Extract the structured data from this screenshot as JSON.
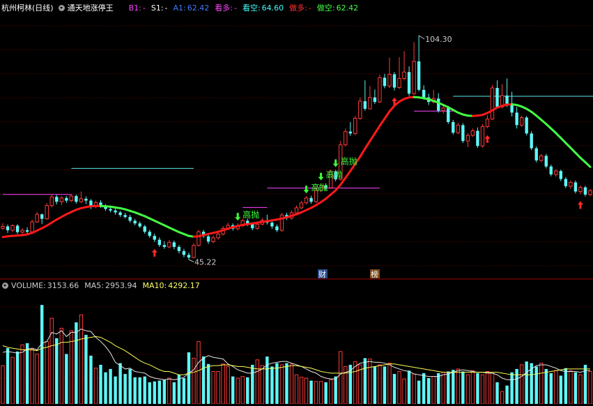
{
  "header": {
    "stock_name": "杭州柯林(日线)",
    "indicator_name": "通天地涨停王",
    "items": [
      {
        "label": "B1:",
        "value": "-",
        "color": "#ff44ff"
      },
      {
        "label": "S1:",
        "value": "-",
        "color": "#ffffff"
      },
      {
        "label": "A1:",
        "value": "62.42",
        "color": "#3f7bff"
      },
      {
        "label": "看多:",
        "value": "-",
        "color": "#ff44ff"
      },
      {
        "label": "看空:",
        "value": "64.60",
        "color": "#44ffff"
      },
      {
        "label": "做多:",
        "value": "-",
        "color": "#ff3333"
      },
      {
        "label": "做空:",
        "value": "62.42",
        "color": "#44ff44"
      }
    ]
  },
  "volume_header": {
    "items": [
      {
        "label": "VOLUME:",
        "value": "3153.66",
        "color": "#cccccc"
      },
      {
        "label": "MA5:",
        "value": "2953.94",
        "color": "#cccccc"
      },
      {
        "label": "MA10:",
        "value": "4292.17",
        "color": "#ffff66"
      }
    ]
  },
  "colors": {
    "up": "#ff3b3b",
    "down": "#5ff5f5",
    "grid": "#7a0000",
    "ma_up": "#ff1a1a",
    "ma_down": "#44ff44"
  },
  "chart_data": {
    "type": "candlestick",
    "price_range": [
      40.5,
      110.0
    ],
    "high_label": "104.30",
    "low_label": "45.22",
    "signal_label": "高抛",
    "badges": [
      "财",
      "榜"
    ],
    "candles": [
      [
        53.5,
        54.0,
        54.9,
        53.1
      ],
      [
        54.0,
        53.0,
        54.5,
        52.3
      ],
      [
        53.0,
        54.2,
        54.6,
        52.5
      ],
      [
        54.2,
        52.5,
        54.6,
        52.0
      ],
      [
        52.5,
        53.0,
        53.5,
        51.9
      ],
      [
        53.0,
        52.6,
        53.8,
        52.0
      ],
      [
        52.6,
        55.2,
        55.8,
        52.4
      ],
      [
        55.2,
        57.2,
        57.8,
        54.9
      ],
      [
        57.2,
        56.0,
        57.4,
        54.6
      ],
      [
        56.0,
        59.5,
        60.1,
        55.8
      ],
      [
        59.5,
        61.8,
        62.5,
        59.0
      ],
      [
        61.8,
        60.5,
        62.3,
        59.8
      ],
      [
        60.5,
        61.5,
        62.0,
        59.6
      ],
      [
        61.5,
        60.8,
        62.0,
        60.2
      ],
      [
        60.8,
        62.0,
        62.6,
        60.4
      ],
      [
        62.0,
        60.5,
        62.4,
        60.0
      ],
      [
        60.5,
        61.3,
        63.2,
        60.2
      ],
      [
        61.3,
        60.8,
        61.9,
        59.9
      ],
      [
        60.8,
        59.2,
        61.2,
        58.6
      ],
      [
        59.2,
        60.3,
        60.8,
        58.8
      ],
      [
        60.3,
        59.4,
        60.9,
        58.9
      ],
      [
        59.4,
        58.6,
        59.9,
        58.1
      ],
      [
        58.6,
        58.2,
        59.2,
        57.7
      ],
      [
        58.2,
        57.7,
        58.7,
        57.1
      ],
      [
        57.7,
        57.0,
        58.1,
        56.5
      ],
      [
        57.0,
        56.5,
        57.6,
        56.1
      ],
      [
        56.5,
        55.5,
        57.1,
        55.0
      ],
      [
        55.5,
        54.8,
        56.0,
        54.3
      ],
      [
        54.8,
        54.0,
        55.3,
        53.6
      ],
      [
        54.0,
        52.6,
        54.4,
        52.1
      ],
      [
        52.6,
        51.5,
        53.1,
        51.0
      ],
      [
        51.5,
        50.5,
        52.1,
        49.9
      ],
      [
        50.5,
        49.1,
        51.1,
        48.6
      ],
      [
        49.1,
        48.6,
        50.1,
        48.1
      ],
      [
        48.6,
        49.8,
        50.4,
        48.2
      ],
      [
        49.8,
        48.6,
        50.3,
        48.0
      ],
      [
        48.6,
        47.5,
        49.1,
        46.9
      ],
      [
        47.5,
        46.5,
        48.1,
        45.9
      ],
      [
        46.5,
        45.8,
        47.1,
        45.22
      ],
      [
        45.8,
        49.0,
        49.6,
        45.6
      ],
      [
        49.0,
        52.6,
        53.1,
        48.7
      ],
      [
        52.6,
        51.4,
        53.1,
        50.9
      ],
      [
        51.4,
        50.0,
        51.9,
        49.4
      ],
      [
        50.0,
        51.0,
        51.6,
        49.6
      ],
      [
        51.0,
        52.0,
        52.6,
        50.5
      ],
      [
        52.0,
        53.5,
        54.1,
        51.6
      ],
      [
        53.5,
        54.3,
        55.0,
        53.0
      ],
      [
        54.3,
        53.4,
        54.8,
        52.9
      ],
      [
        53.4,
        54.2,
        54.8,
        52.9
      ],
      [
        54.2,
        55.5,
        56.0,
        53.8
      ],
      [
        55.5,
        54.6,
        56.1,
        54.1
      ],
      [
        54.6,
        53.5,
        55.1,
        53.0
      ],
      [
        53.5,
        54.6,
        55.2,
        53.1
      ],
      [
        54.6,
        55.6,
        56.2,
        54.3
      ],
      [
        55.6,
        55.0,
        57.1,
        54.5
      ],
      [
        55.0,
        54.0,
        55.6,
        53.4
      ],
      [
        54.0,
        53.0,
        54.5,
        52.5
      ],
      [
        53.0,
        57.0,
        57.6,
        52.6
      ],
      [
        57.0,
        56.2,
        57.6,
        55.7
      ],
      [
        56.2,
        57.6,
        58.2,
        55.8
      ],
      [
        57.6,
        58.9,
        59.5,
        57.2
      ],
      [
        58.9,
        60.2,
        60.7,
        58.5
      ],
      [
        60.2,
        61.5,
        62.0,
        59.8
      ],
      [
        61.5,
        60.5,
        62.1,
        60.0
      ],
      [
        60.5,
        63.5,
        64.1,
        60.2
      ],
      [
        63.5,
        64.8,
        65.4,
        63.1
      ],
      [
        64.8,
        64.2,
        65.3,
        63.6
      ],
      [
        64.2,
        68.5,
        69.0,
        63.9
      ],
      [
        68.5,
        66.4,
        68.9,
        65.9
      ],
      [
        66.4,
        75.5,
        76.5,
        66.1
      ],
      [
        75.5,
        79.0,
        79.8,
        75.1
      ],
      [
        79.0,
        78.5,
        81.5,
        77.9
      ],
      [
        78.5,
        82.5,
        83.1,
        78.0
      ],
      [
        82.5,
        87.0,
        88.0,
        82.1
      ],
      [
        87.0,
        85.0,
        92.5,
        84.5
      ],
      [
        85.0,
        88.0,
        91.0,
        84.8
      ],
      [
        88.0,
        86.8,
        90.1,
        86.3
      ],
      [
        86.8,
        93.2,
        94.0,
        86.5
      ],
      [
        93.2,
        91.0,
        94.2,
        90.4
      ],
      [
        91.0,
        94.1,
        98.5,
        90.5
      ],
      [
        94.1,
        90.6,
        94.7,
        89.8
      ],
      [
        90.6,
        93.0,
        98.6,
        90.2
      ],
      [
        93.0,
        94.7,
        100.2,
        92.5
      ],
      [
        94.7,
        89.0,
        96.2,
        88.4
      ],
      [
        89.0,
        97.5,
        102.6,
        88.6
      ],
      [
        97.5,
        90.0,
        104.3,
        89.6
      ],
      [
        90.0,
        88.0,
        91.2,
        87.4
      ],
      [
        88.0,
        86.8,
        89.0,
        86.0
      ],
      [
        86.8,
        87.7,
        90.0,
        86.4
      ],
      [
        87.7,
        84.5,
        89.1,
        84.0
      ],
      [
        84.5,
        85.2,
        86.1,
        83.8
      ],
      [
        85.2,
        81.5,
        85.8,
        81.0
      ],
      [
        81.5,
        78.7,
        82.1,
        78.2
      ],
      [
        78.7,
        80.7,
        81.3,
        78.3
      ],
      [
        80.7,
        76.5,
        81.2,
        76.0
      ],
      [
        76.5,
        78.0,
        78.6,
        74.9
      ],
      [
        78.0,
        79.2,
        79.8,
        77.6
      ],
      [
        79.2,
        75.2,
        80.1,
        74.7
      ],
      [
        75.2,
        80.3,
        81.0,
        74.8
      ],
      [
        80.3,
        82.3,
        83.3,
        79.9
      ],
      [
        82.3,
        90.5,
        91.3,
        82.0
      ],
      [
        90.5,
        85.5,
        92.5,
        85.0
      ],
      [
        85.5,
        88.5,
        91.5,
        85.1
      ],
      [
        88.5,
        86.0,
        93.0,
        85.5
      ],
      [
        86.0,
        84.0,
        89.5,
        83.0
      ],
      [
        84.0,
        80.7,
        85.5,
        79.8
      ],
      [
        80.7,
        82.7,
        83.2,
        80.2
      ],
      [
        82.7,
        78.5,
        83.1,
        78.0
      ],
      [
        78.5,
        74.6,
        79.1,
        74.1
      ],
      [
        74.6,
        71.4,
        75.1,
        70.9
      ],
      [
        71.4,
        72.6,
        73.1,
        70.9
      ],
      [
        72.6,
        69.8,
        73.1,
        69.3
      ],
      [
        69.8,
        67.7,
        70.3,
        67.2
      ],
      [
        67.7,
        68.6,
        69.1,
        67.1
      ],
      [
        68.6,
        66.5,
        69.0,
        65.9
      ],
      [
        66.5,
        64.6,
        67.0,
        64.1
      ],
      [
        64.6,
        65.6,
        66.1,
        63.9
      ],
      [
        65.6,
        63.2,
        66.1,
        62.7
      ],
      [
        63.2,
        64.3,
        64.8,
        62.5
      ],
      [
        64.3,
        62.4,
        64.7,
        61.9
      ],
      [
        62.4,
        63.4,
        63.9,
        62.0
      ]
    ],
    "ma": [
      51.2,
      51.4,
      51.5,
      51.6,
      51.7,
      51.9,
      52.3,
      52.9,
      53.5,
      54.2,
      55.0,
      55.8,
      56.5,
      57.2,
      57.8,
      58.4,
      58.8,
      59.1,
      59.3,
      59.4,
      59.4,
      59.3,
      59.2,
      59.0,
      58.8,
      58.5,
      58.1,
      57.7,
      57.2,
      56.7,
      56.1,
      55.5,
      54.9,
      54.3,
      53.7,
      53.1,
      52.5,
      52.0,
      51.5,
      51.3,
      51.4,
      51.7,
      52.0,
      52.3,
      52.6,
      53.0,
      53.4,
      53.8,
      54.1,
      54.4,
      54.6,
      54.8,
      55.0,
      55.2,
      55.4,
      55.6,
      55.8,
      56.1,
      56.4,
      56.8,
      57.2,
      57.7,
      58.3,
      58.9,
      59.6,
      60.4,
      61.3,
      62.4,
      63.5,
      65.0,
      66.8,
      68.6,
      70.5,
      72.4,
      74.5,
      76.5,
      78.5,
      80.5,
      82.4,
      84.3,
      85.8,
      86.9,
      87.6,
      88.0,
      88.1,
      88.0,
      87.8,
      87.5,
      87.1,
      86.6,
      86.0,
      85.4,
      84.7,
      84.0,
      83.5,
      83.2,
      83.1,
      83.2,
      83.4,
      83.9,
      84.6,
      85.3,
      85.8,
      86.1,
      86.2,
      86.0,
      85.6,
      85.0,
      84.2,
      83.2,
      82.1,
      81.0,
      79.8,
      78.6,
      77.3,
      76.0,
      74.7,
      73.4,
      72.1,
      70.9,
      69.7
    ],
    "hlines": [
      {
        "y": 62.42,
        "color": "#ff44ff",
        "from": 0,
        "to": 14
      },
      {
        "y": 69.3,
        "color": "#55eeee",
        "from": 14,
        "to": 39
      },
      {
        "y": 59.0,
        "color": "#ff44ff",
        "from": 49,
        "to": 54
      },
      {
        "y": 64.1,
        "color": "#ff44ff",
        "from": 54,
        "to": 77
      },
      {
        "y": 84.4,
        "color": "#ff44ff",
        "from": 84,
        "to": 92
      },
      {
        "y": 88.3,
        "color": "#55eeee",
        "from": 92,
        "to": 121
      }
    ],
    "buy_arrows": [
      31,
      80,
      99,
      118
    ],
    "sell_signals": [
      48,
      62,
      65,
      68
    ],
    "volume": {
      "range": [
        0,
        13500
      ],
      "values": [
        4600,
        6700,
        5600,
        6300,
        7100,
        7300,
        6600,
        6000,
        11900,
        7500,
        10300,
        7900,
        9100,
        6000,
        8800,
        9800,
        10700,
        8300,
        5800,
        4300,
        4700,
        3800,
        4200,
        3300,
        4900,
        3600,
        4200,
        3200,
        3200,
        3300,
        2600,
        2700,
        2800,
        2900,
        3100,
        2600,
        3500,
        3100,
        6200,
        5500,
        7500,
        5700,
        4800,
        3900,
        3900,
        4800,
        4500,
        3300,
        3100,
        3300,
        3200,
        4700,
        5300,
        4600,
        5700,
        4500,
        4900,
        4700,
        4900,
        4800,
        3500,
        3200,
        3100,
        2800,
        2700,
        2700,
        2600,
        2900,
        3300,
        6300,
        4500,
        4700,
        5100,
        4700,
        5500,
        5400,
        4500,
        4700,
        4500,
        4900,
        3600,
        3900,
        3000,
        4000,
        3600,
        2800,
        3700,
        3100,
        3300,
        3700,
        3800,
        3900,
        4100,
        4200,
        3900,
        3500,
        4000,
        3700,
        3500,
        3900,
        3700,
        2600,
        1500,
        2200,
        3800,
        4200,
        4700,
        5100,
        4900,
        4500,
        4900,
        4200,
        3700,
        4000,
        3400,
        4300,
        4000,
        3800,
        3500,
        4700,
        3900
      ],
      "ma5": [
        6200,
        6300,
        6200,
        6100,
        6200,
        6600,
        6700,
        6500,
        7300,
        7500,
        8600,
        8400,
        8800,
        8100,
        8600,
        8600,
        9000,
        8800,
        8700,
        8000,
        7500,
        6900,
        6100,
        5000,
        4600,
        4200,
        4300,
        3900,
        3800,
        3700,
        3300,
        3100,
        3000,
        2900,
        3000,
        2900,
        3000,
        3200,
        3700,
        4100,
        5000,
        5500,
        5800,
        5600,
        5500,
        5400,
        4800,
        4500,
        4100,
        3900,
        3700,
        3700,
        3900,
        4200,
        4700,
        4900,
        5000,
        5100,
        5100,
        4900,
        4700,
        4500,
        4200,
        3900,
        3700,
        3300,
        3100,
        3000,
        3000,
        3600,
        3800,
        4000,
        4500,
        4900,
        5000,
        5100,
        5000,
        5000,
        4900,
        4700,
        4400,
        4200,
        4000,
        3900,
        3600,
        3500,
        3400,
        3300,
        3300,
        3300,
        3500,
        3600,
        3800,
        4000,
        4100,
        4000,
        3900,
        3800,
        3800,
        3700,
        3700,
        3500,
        3100,
        2900,
        2900,
        3000,
        3300,
        3800,
        4200,
        4600,
        4700,
        4700,
        4500,
        4300,
        4000,
        3900,
        3900,
        3900,
        3800,
        4000,
        4000
      ],
      "ma10": [
        7000,
        6800,
        6700,
        6600,
        6500,
        6500,
        6500,
        6400,
        6700,
        6800,
        7000,
        7100,
        7400,
        7400,
        7500,
        7600,
        7800,
        7900,
        8000,
        8100,
        8000,
        7700,
        7400,
        7000,
        6700,
        6400,
        6000,
        5600,
        5200,
        4900,
        4700,
        4400,
        4100,
        3900,
        3900,
        3700,
        3500,
        3500,
        3700,
        3800,
        4000,
        4300,
        4500,
        4600,
        4600,
        4700,
        4700,
        4600,
        4500,
        4500,
        4400,
        4300,
        4200,
        4200,
        4200,
        4300,
        4300,
        4400,
        4500,
        4600,
        4600,
        4500,
        4400,
        4300,
        4100,
        3900,
        3800,
        3700,
        3700,
        3700,
        3700,
        3800,
        3900,
        4100,
        4300,
        4400,
        4500,
        4600,
        4700,
        4800,
        4800,
        4700,
        4600,
        4500,
        4400,
        4300,
        4200,
        4100,
        4000,
        3900,
        3800,
        3800,
        3800,
        3800,
        3800,
        3800,
        3800,
        3800,
        3800,
        3800,
        3800,
        3800,
        3700,
        3600,
        3500,
        3500,
        3500,
        3500,
        3500,
        3600,
        3700,
        3800,
        3900,
        4000,
        4100,
        4200,
        4200,
        4200,
        4200,
        4200,
        4200
      ]
    }
  }
}
